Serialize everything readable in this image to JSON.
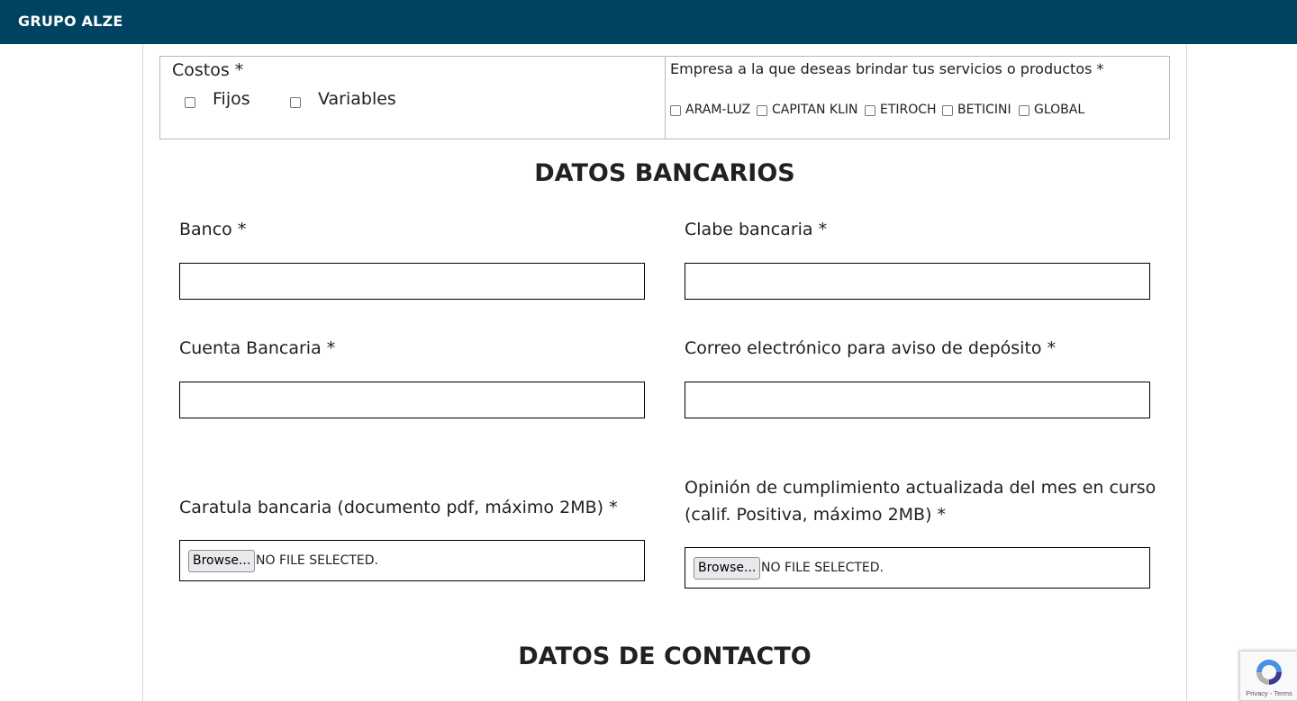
{
  "header": {
    "brand": "GRUPO ALZE",
    "bg_color": "#004361"
  },
  "costos": {
    "title": "Costos *",
    "options": [
      {
        "label": "Fijos",
        "checked": false
      },
      {
        "label": "Variables",
        "checked": false
      }
    ]
  },
  "empresa": {
    "title": "Empresa a la que deseas brindar tus servicios o productos *",
    "options": [
      {
        "label": "ARAM-LUZ",
        "checked": false
      },
      {
        "label": "CAPITAN KLIN",
        "checked": false
      },
      {
        "label": "ETIROCH",
        "checked": false
      },
      {
        "label": "BETICINI",
        "checked": false
      },
      {
        "label": "GLOBAL",
        "checked": false
      }
    ]
  },
  "datos_bancarios": {
    "title": "DATOS BANCARIOS",
    "banco": {
      "label": "Banco *",
      "value": ""
    },
    "clabe": {
      "label": "Clabe bancaria *",
      "value": ""
    },
    "cuenta": {
      "label": "Cuenta Bancaria *",
      "value": ""
    },
    "correo": {
      "label": "Correo electrónico para aviso de depósito *",
      "value": ""
    },
    "caratula": {
      "label": "Caratula bancaria (documento pdf, máximo 2MB) *",
      "browse": "Browse...",
      "status": "NO FILE SELECTED."
    },
    "opinion": {
      "label_line1": "Opinión de cumplimiento actualizada del mes en curso",
      "label_line2": "(calif. Positiva, máximo 2MB) *",
      "browse": "Browse...",
      "status": "NO FILE SELECTED."
    }
  },
  "datos_contacto": {
    "title": "DATOS DE CONTACTO"
  },
  "recaptcha": {
    "links": "Privacy - Terms",
    "icon": "recaptcha-icon"
  }
}
